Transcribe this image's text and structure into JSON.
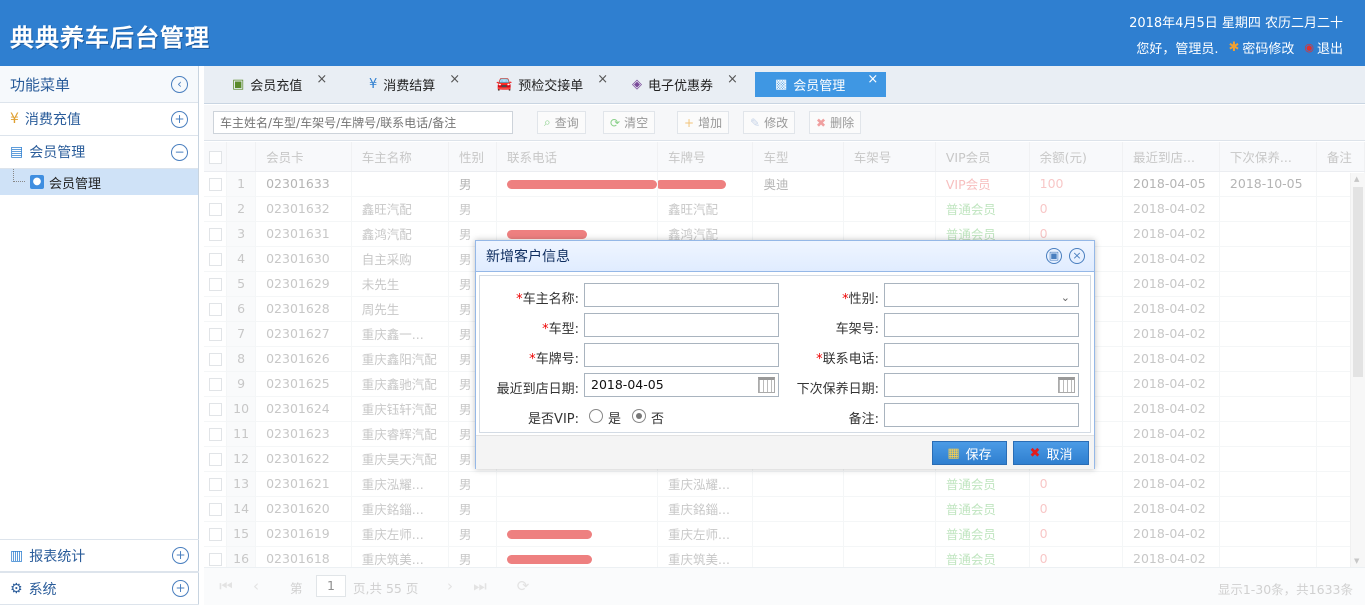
{
  "header": {
    "logo": "典典养车后台管理",
    "date": "2018年4月5日 星期四 农历二月二十",
    "greeting": "您好，管理员.",
    "change_password": "密码修改",
    "logout": "退出"
  },
  "sidebar": {
    "title": "功能菜单",
    "sections": {
      "recharge": "消费充值",
      "member": "会员管理",
      "member_sub": "会员管理",
      "report": "报表统计",
      "system": "系统"
    }
  },
  "tabs": [
    "会员充值",
    "消费结算",
    "预检交接单",
    "电子优惠券",
    "会员管理"
  ],
  "toolbar": {
    "search_placeholder": "车主姓名/车型/车架号/车牌号/联系电话/备注",
    "query": "查询",
    "clear": "清空",
    "add": "增加",
    "edit": "修改",
    "delete": "删除"
  },
  "table": {
    "headers": [
      "会员卡",
      "车主名称",
      "性别",
      "联系电话",
      "车牌号",
      "车型",
      "车架号",
      "VIP会员",
      "余额(元)",
      "最近到店...",
      "下次保养...",
      "备注"
    ],
    "rows": [
      {
        "n": "1",
        "card": "02301633",
        "name": "",
        "sex": "男",
        "phone": "",
        "plate": "",
        "model": "奥迪",
        "vin": "",
        "vip": "VIP会员",
        "bal": "100",
        "last": "2018-04-05",
        "next": "2018-10-05"
      },
      {
        "n": "2",
        "card": "02301632",
        "name": "鑫旺汽配",
        "sex": "男",
        "phone": "",
        "plate": "鑫旺汽配",
        "model": "",
        "vin": "",
        "vip": "普通会员",
        "bal": "0",
        "last": "2018-04-02",
        "next": ""
      },
      {
        "n": "3",
        "card": "02301631",
        "name": "鑫鸿汽配",
        "sex": "男",
        "phone": "",
        "plate": "鑫鸿汽配",
        "model": "",
        "vin": "",
        "vip": "普通会员",
        "bal": "0",
        "last": "2018-04-02",
        "next": ""
      },
      {
        "n": "4",
        "card": "02301630",
        "name": "自主采购",
        "sex": "男",
        "phone": "",
        "plate": "",
        "model": "",
        "vin": "",
        "vip": "",
        "bal": "",
        "last": "2018-04-02",
        "next": ""
      },
      {
        "n": "5",
        "card": "02301629",
        "name": "未先生",
        "sex": "男",
        "phone": "",
        "plate": "",
        "model": "",
        "vin": "",
        "vip": "",
        "bal": "",
        "last": "2018-04-02",
        "next": ""
      },
      {
        "n": "6",
        "card": "02301628",
        "name": "周先生",
        "sex": "男",
        "phone": "",
        "plate": "",
        "model": "",
        "vin": "",
        "vip": "",
        "bal": "",
        "last": "2018-04-02",
        "next": ""
      },
      {
        "n": "7",
        "card": "02301627",
        "name": "重庆鑫一...",
        "sex": "男",
        "phone": "",
        "plate": "",
        "model": "",
        "vin": "",
        "vip": "",
        "bal": "",
        "last": "2018-04-02",
        "next": ""
      },
      {
        "n": "8",
        "card": "02301626",
        "name": "重庆鑫阳汽配",
        "sex": "男",
        "phone": "",
        "plate": "",
        "model": "",
        "vin": "",
        "vip": "",
        "bal": "",
        "last": "2018-04-02",
        "next": ""
      },
      {
        "n": "9",
        "card": "02301625",
        "name": "重庆鑫驰汽配",
        "sex": "男",
        "phone": "",
        "plate": "",
        "model": "",
        "vin": "",
        "vip": "",
        "bal": "",
        "last": "2018-04-02",
        "next": ""
      },
      {
        "n": "10",
        "card": "02301624",
        "name": "重庆钰轩汽配",
        "sex": "男",
        "phone": "",
        "plate": "",
        "model": "",
        "vin": "",
        "vip": "",
        "bal": "",
        "last": "2018-04-02",
        "next": ""
      },
      {
        "n": "11",
        "card": "02301623",
        "name": "重庆睿辉汽配",
        "sex": "男",
        "phone": "",
        "plate": "",
        "model": "",
        "vin": "",
        "vip": "",
        "bal": "",
        "last": "2018-04-02",
        "next": ""
      },
      {
        "n": "12",
        "card": "02301622",
        "name": "重庆昊天汽配",
        "sex": "男",
        "phone": "",
        "plate": "",
        "model": "",
        "vin": "",
        "vip": "",
        "bal": "",
        "last": "2018-04-02",
        "next": ""
      },
      {
        "n": "13",
        "card": "02301621",
        "name": "重庆泓耀...",
        "sex": "男",
        "phone": "",
        "plate": "重庆泓耀...",
        "model": "",
        "vin": "",
        "vip": "普通会员",
        "bal": "0",
        "last": "2018-04-02",
        "next": ""
      },
      {
        "n": "14",
        "card": "02301620",
        "name": "重庆銘錙...",
        "sex": "男",
        "phone": "",
        "plate": "重庆銘錙...",
        "model": "",
        "vin": "",
        "vip": "普通会员",
        "bal": "0",
        "last": "2018-04-02",
        "next": ""
      },
      {
        "n": "15",
        "card": "02301619",
        "name": "重庆左师...",
        "sex": "男",
        "phone": "",
        "plate": "重庆左师...",
        "model": "",
        "vin": "",
        "vip": "普通会员",
        "bal": "0",
        "last": "2018-04-02",
        "next": ""
      },
      {
        "n": "16",
        "card": "02301618",
        "name": "重庆筑美...",
        "sex": "男",
        "phone": "",
        "plate": "重庆筑美...",
        "model": "",
        "vin": "",
        "vip": "普通会员",
        "bal": "0",
        "last": "2018-04-02",
        "next": ""
      }
    ]
  },
  "pager": {
    "page_prefix": "第",
    "page": "1",
    "page_suffix": "页,共 55 页",
    "info": "显示1-30条，共1633条"
  },
  "dialog": {
    "title": "新增客户信息",
    "labels": {
      "owner": "车主名称:",
      "gender": "性别:",
      "model": "车型:",
      "vin": "车架号:",
      "plate": "车牌号:",
      "phone": "联系电话:",
      "last_visit": "最近到店日期:",
      "next_service": "下次保养日期:",
      "is_vip": "是否VIP:",
      "yes": "是",
      "no": "否",
      "remark": "备注:"
    },
    "required_mark": "*",
    "values": {
      "last_visit": "2018-04-05"
    },
    "save": "保存",
    "cancel": "取消"
  }
}
